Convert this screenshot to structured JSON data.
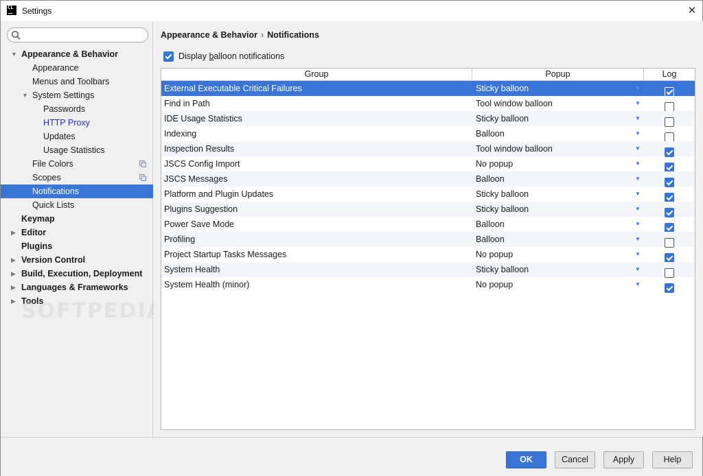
{
  "window": {
    "title": "Settings",
    "app_icon_text": "CL",
    "close_glyph": "✕"
  },
  "search": {
    "value": "",
    "placeholder": ""
  },
  "sidebar": {
    "items": [
      {
        "label": "Appearance & Behavior",
        "bold": true,
        "arrow": "▼",
        "indent": 0
      },
      {
        "label": "Appearance",
        "indent": 1
      },
      {
        "label": "Menus and Toolbars",
        "indent": 1
      },
      {
        "label": "System Settings",
        "arrow": "▼",
        "indent": 1
      },
      {
        "label": "Passwords",
        "indent": 2
      },
      {
        "label": "HTTP Proxy",
        "indent": 2,
        "link": true
      },
      {
        "label": "Updates",
        "indent": 2
      },
      {
        "label": "Usage Statistics",
        "indent": 2
      },
      {
        "label": "File Colors",
        "indent": 1,
        "copy_icon": true
      },
      {
        "label": "Scopes",
        "indent": 1,
        "copy_icon": true
      },
      {
        "label": "Notifications",
        "indent": 1,
        "selected": true
      },
      {
        "label": "Quick Lists",
        "indent": 1
      },
      {
        "label": "Keymap",
        "bold": true,
        "indent": 0
      },
      {
        "label": "Editor",
        "bold": true,
        "arrow": "▶",
        "indent": 0
      },
      {
        "label": "Plugins",
        "bold": true,
        "indent": 0
      },
      {
        "label": "Version Control",
        "bold": true,
        "arrow": "▶",
        "indent": 0
      },
      {
        "label": "Build, Execution, Deployment",
        "bold": true,
        "arrow": "▶",
        "indent": 0
      },
      {
        "label": "Languages & Frameworks",
        "bold": true,
        "arrow": "▶",
        "indent": 0
      },
      {
        "label": "Tools",
        "bold": true,
        "arrow": "▶",
        "indent": 0
      }
    ]
  },
  "breadcrumb": {
    "parent": "Appearance & Behavior",
    "separator": "›",
    "current": "Notifications"
  },
  "display_balloon": {
    "label_prefix": "Display ",
    "label_mnemonic": "b",
    "label_suffix": "alloon notifications",
    "checked": true
  },
  "table": {
    "headers": {
      "group": "Group",
      "popup": "Popup",
      "log": "Log"
    },
    "caret_glyph": "▼",
    "rows": [
      {
        "group": "External Executable Critical Failures",
        "popup": "Sticky balloon",
        "log": true,
        "selected": true
      },
      {
        "group": "Find in Path",
        "popup": "Tool window balloon",
        "log": false
      },
      {
        "group": "IDE Usage Statistics",
        "popup": "Sticky balloon",
        "log": false
      },
      {
        "group": "Indexing",
        "popup": "Balloon",
        "log": false
      },
      {
        "group": "Inspection Results",
        "popup": "Tool window balloon",
        "log": true
      },
      {
        "group": "JSCS Config Import",
        "popup": "No popup",
        "log": true
      },
      {
        "group": "JSCS Messages",
        "popup": "Balloon",
        "log": true
      },
      {
        "group": "Platform and Plugin Updates",
        "popup": "Sticky balloon",
        "log": true
      },
      {
        "group": "Plugins Suggestion",
        "popup": "Sticky balloon",
        "log": true
      },
      {
        "group": "Power Save Mode",
        "popup": "Balloon",
        "log": true
      },
      {
        "group": "Profiling",
        "popup": "Balloon",
        "log": false
      },
      {
        "group": "Project Startup Tasks Messages",
        "popup": "No popup",
        "log": true
      },
      {
        "group": "System Health",
        "popup": "Sticky balloon",
        "log": false
      },
      {
        "group": "System Health (minor)",
        "popup": "No popup",
        "log": true
      }
    ]
  },
  "footer": {
    "ok_label": "OK",
    "cancel_label": "Cancel",
    "apply_label": "Apply",
    "help_label": "Help"
  },
  "watermark": "SOFTPEDIA",
  "colors": {
    "accent": "#3875d6",
    "link": "#2a2ad0",
    "row_alt": "#f2f5f9"
  }
}
